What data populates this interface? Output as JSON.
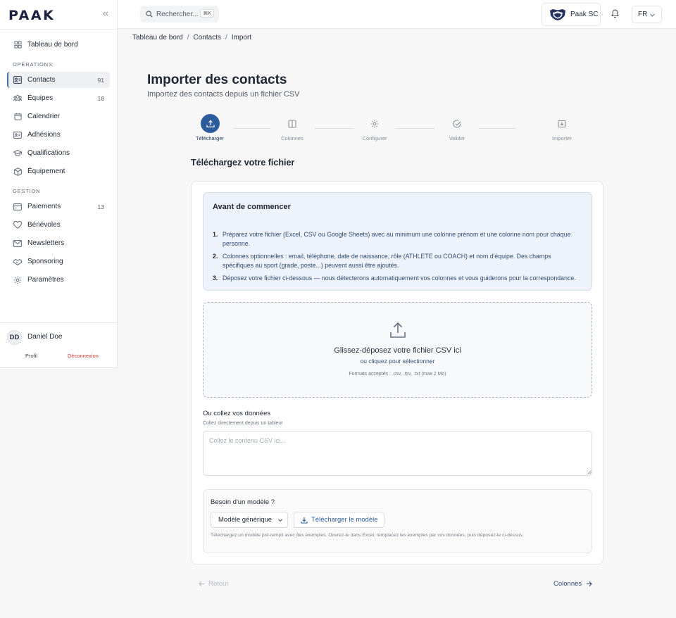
{
  "brand": {
    "logo": "PAAK"
  },
  "sidebar": {
    "items_top": [
      {
        "label": "Tableau de bord",
        "icon": "dashboard-icon",
        "count": ""
      }
    ],
    "section_operations": "OPÉRATIONS",
    "items_operations": [
      {
        "label": "Contacts",
        "icon": "contacts-icon",
        "count": "91",
        "active": true
      },
      {
        "label": "Équipes",
        "icon": "teams-icon",
        "count": "18"
      },
      {
        "label": "Calendrier",
        "icon": "calendar-icon",
        "count": ""
      },
      {
        "label": "Adhésions",
        "icon": "membership-card-icon",
        "count": ""
      },
      {
        "label": "Qualifications",
        "icon": "graduation-cap-icon",
        "count": ""
      },
      {
        "label": "Équipement",
        "icon": "package-icon",
        "count": ""
      }
    ],
    "section_gestion": "GESTION",
    "items_gestion": [
      {
        "label": "Paiements",
        "icon": "wallet-icon",
        "count": "13"
      },
      {
        "label": "Bénévoles",
        "icon": "heart-icon",
        "count": ""
      },
      {
        "label": "Newsletters",
        "icon": "mail-icon",
        "count": ""
      },
      {
        "label": "Sponsoring",
        "icon": "handshake-icon",
        "count": ""
      },
      {
        "label": "Paramètres",
        "icon": "gear-icon",
        "count": ""
      }
    ],
    "user": {
      "initials": "DD",
      "name": "Daniel Doe",
      "profile": "Profil",
      "logout": "Déconnexion"
    }
  },
  "topbar": {
    "search_placeholder": "Rechercher...",
    "search_shortcut": "⌘K",
    "club_name": "Paak SC",
    "language": "FR"
  },
  "breadcrumb": {
    "home": "Tableau de bord",
    "contacts": "Contacts",
    "current": "Import"
  },
  "page": {
    "title": "Importer des contacts",
    "subtitle": "Importez des contacts depuis un fichier CSV"
  },
  "stepper": [
    {
      "label": "Télécharger",
      "icon": "upload-icon",
      "active": true
    },
    {
      "label": "Colonnes",
      "icon": "columns-icon",
      "active": false
    },
    {
      "label": "Configurer",
      "icon": "gear-icon",
      "active": false
    },
    {
      "label": "Valider",
      "icon": "check-circle-icon",
      "active": false
    },
    {
      "label": "Importer",
      "icon": "import-icon",
      "active": false
    }
  ],
  "upload": {
    "section_title": "Téléchargez votre fichier",
    "info_title": "Avant de commencer",
    "info_items": [
      {
        "num": "1.",
        "text": "Préparez votre fichier (Excel, CSV ou Google Sheets) avec au minimum une colonne prénom et une colonne nom pour chaque personne."
      },
      {
        "num": "2.",
        "text": "Colonnes optionnelles : email, téléphone, date de naissance, rôle (ATHLETE ou COACH) et nom d'équipe. Des champs spécifiques au sport (grade, poste...) peuvent aussi être ajoutés."
      },
      {
        "num": "3.",
        "text": "Déposez votre fichier ci-dessous — nous détecterons automatiquement vos colonnes et vous guiderons pour la correspondance."
      }
    ],
    "drop_title": "Glissez-déposez votre fichier CSV ici",
    "drop_sub": "ou cliquez pour sélectionner",
    "drop_formats": "Formats acceptés : .csv, .tsv, .txt (max 2 Mo)",
    "paste_title": "Ou collez vos données",
    "paste_sub": "Collez directement depuis un tableur",
    "paste_placeholder": "Collez le contenu CSV ici...",
    "template_question": "Besoin d'un modèle ?",
    "template_selected": "Modèle générique",
    "template_download": "Télécharger le modèle",
    "template_hint": "Téléchargez un modèle pré-rempli avec des exemples. Ouvrez-le dans Excel, remplacez les exemples par vos données, puis déposez-le ci-dessus."
  },
  "footer": {
    "back": "Retour",
    "next": "Colonnes"
  }
}
